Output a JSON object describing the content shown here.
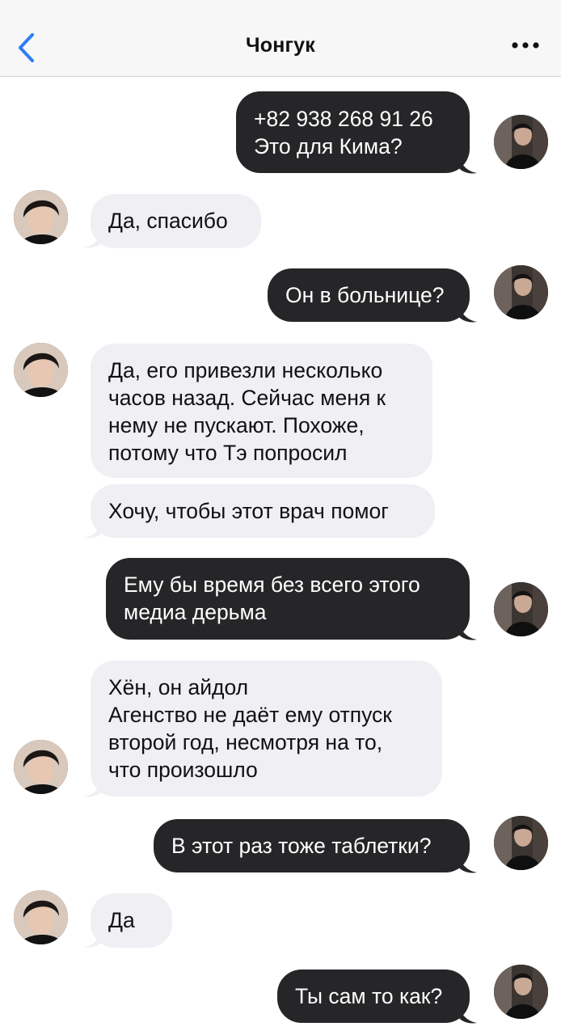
{
  "header": {
    "title": "Чонгук"
  },
  "icons": {
    "back": "chevron-left-icon",
    "more": "ellipsis-icon",
    "accent": "#2e7cf6"
  },
  "colors": {
    "outgoing_bubble": "#262628",
    "incoming_bubble": "#efeff4"
  },
  "messages": [
    {
      "direction": "outgoing",
      "text": "+82 938 268 91 26\nЭто для Кима?"
    },
    {
      "direction": "incoming",
      "text": "Да, спасибо"
    },
    {
      "direction": "outgoing",
      "text": "Он в больнице?"
    },
    {
      "direction": "incoming",
      "text": "Да, его привезли несколько\nчасов назад. Сейчас меня к\nнему не пускают. Похоже,\nпотому что Тэ попросил"
    },
    {
      "direction": "incoming",
      "text": "Хочу, чтобы этот врач помог"
    },
    {
      "direction": "outgoing",
      "text": "Ему бы время без всего этого\nмедиа дерьма"
    },
    {
      "direction": "incoming",
      "text": "Хён, он айдол\nАгенство не даёт ему отпуск\nвторой год, несмотря на то,\nчто произошло"
    },
    {
      "direction": "outgoing",
      "text": "В этот раз тоже таблетки?"
    },
    {
      "direction": "incoming",
      "text": "Да"
    },
    {
      "direction": "outgoing",
      "text": "Ты сам то как?"
    }
  ]
}
